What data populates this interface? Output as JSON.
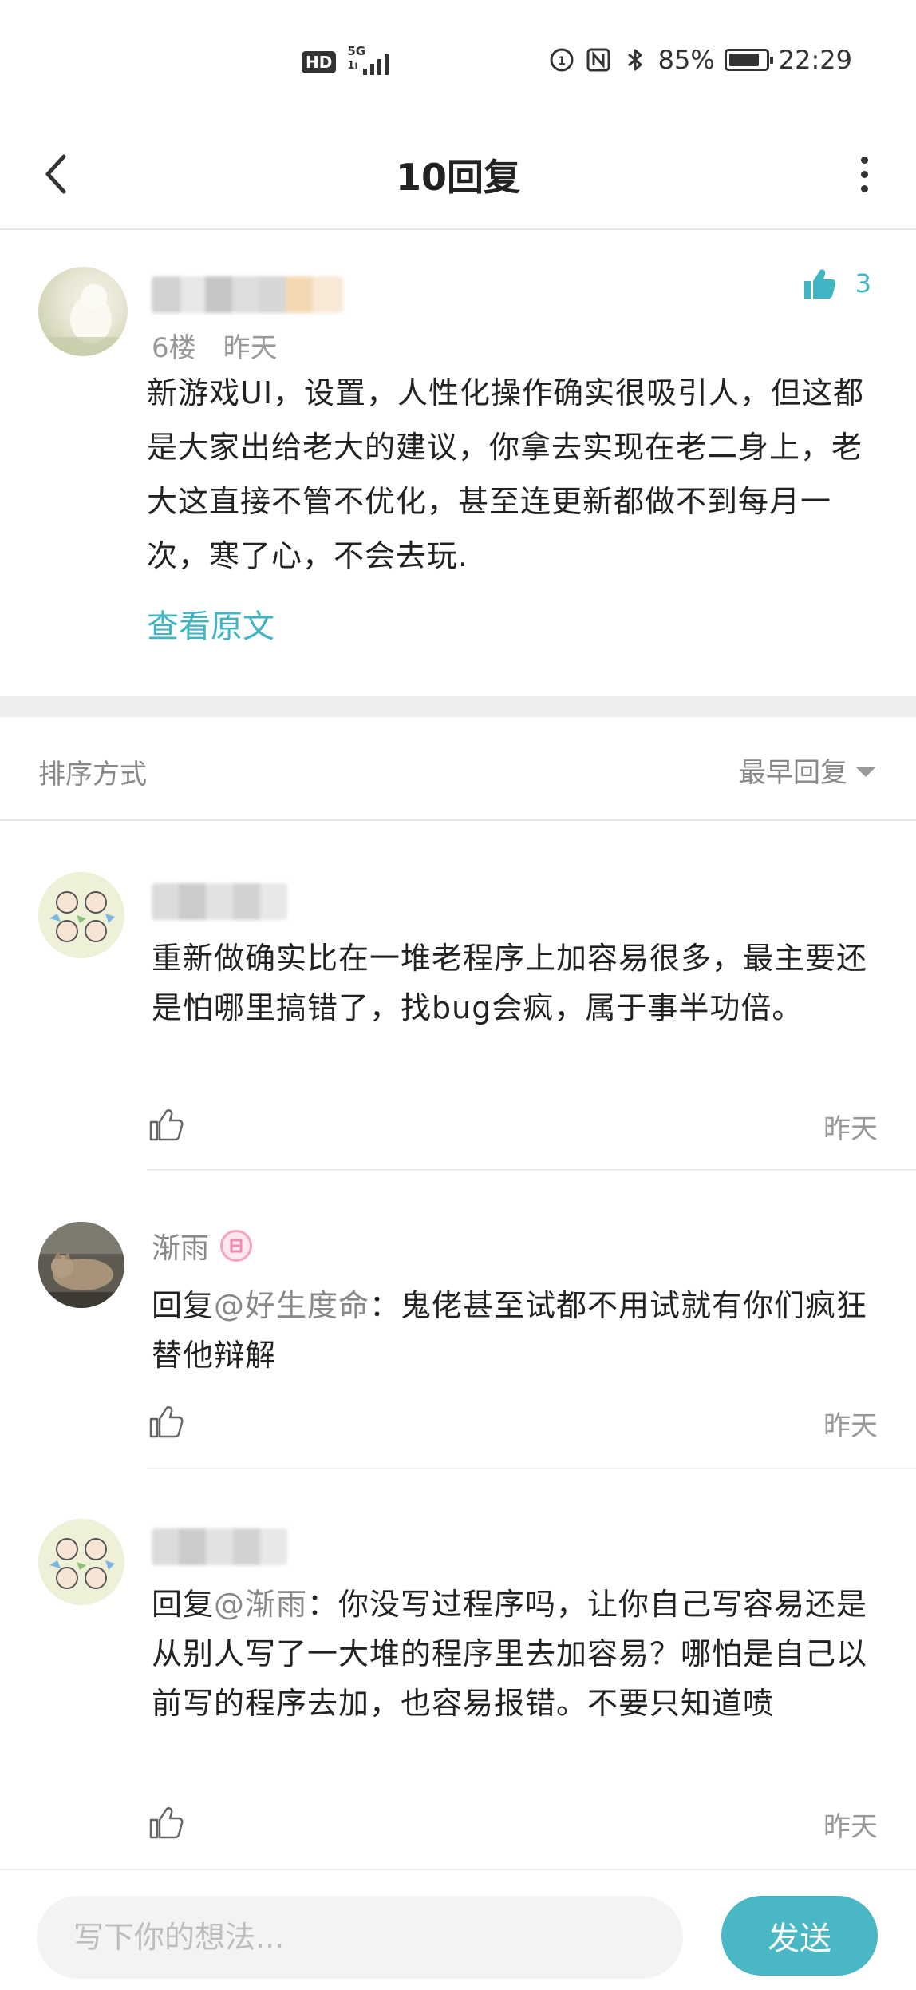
{
  "status_bar": {
    "hd": "HD",
    "network": "5G",
    "network_sub": "1ı",
    "battery": "85%",
    "battery_level": 0.85,
    "time": "22:29"
  },
  "header": {
    "title": "10回复"
  },
  "post": {
    "floor": "6楼",
    "time": "昨天",
    "like_count": "3",
    "body": "新游戏UI，设置，人性化操作确实很吸引人，但这都是大家出给老大的建议，你拿去实现在老二身上，老大这直接不管不优化，甚至连更新都做不到每月一次，寒了心，不会去玩.",
    "view_original": "查看原文"
  },
  "sort": {
    "label": "排序方式",
    "value": "最早回复"
  },
  "replies": [
    {
      "nickname": "",
      "body": "重新做确实比在一堆老程序上加容易很多，最主要还是怕哪里搞错了，找bug会疯，属于事半功倍。",
      "time": "昨天"
    },
    {
      "nickname": "渐雨",
      "reply_prefix": "回复",
      "mention": "@好生度命",
      "body": "：鬼佬甚至试都不用试就有你们疯狂替他辩解",
      "time": "昨天"
    },
    {
      "nickname": "",
      "reply_prefix": "回复",
      "mention": "@渐雨",
      "body": "：你没写过程序吗，让你自己写容易还是从别人写了一大堆的程序里去加容易？哪怕是自己以前写的程序去加，也容易报错。不要只知道喷",
      "time": "昨天"
    }
  ],
  "composer": {
    "placeholder": "写下你的想法...",
    "send_label": "发送"
  },
  "colors": {
    "accent": "#3fb5c4",
    "send_button": "#4ab8c4",
    "muted_text": "#999999"
  }
}
